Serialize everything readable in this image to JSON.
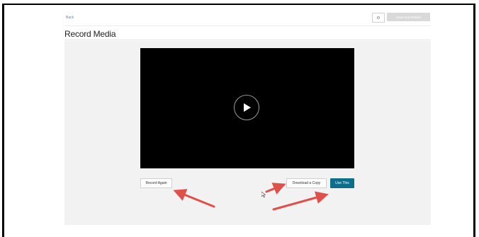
{
  "header": {
    "back_label": "Back",
    "save_exit_label": "Save and Embed",
    "settings_icon": "gear-icon"
  },
  "page": {
    "title": "Record Media"
  },
  "player": {
    "play_icon": "play-icon"
  },
  "actions": {
    "record_again_label": "Record Again",
    "download_copy_label": "Download a Copy",
    "use_this_label": "Use This"
  },
  "colors": {
    "accent": "#0d6e8c",
    "annotation_arrow": "#e0504a",
    "content_bg": "#f2f2f2"
  }
}
